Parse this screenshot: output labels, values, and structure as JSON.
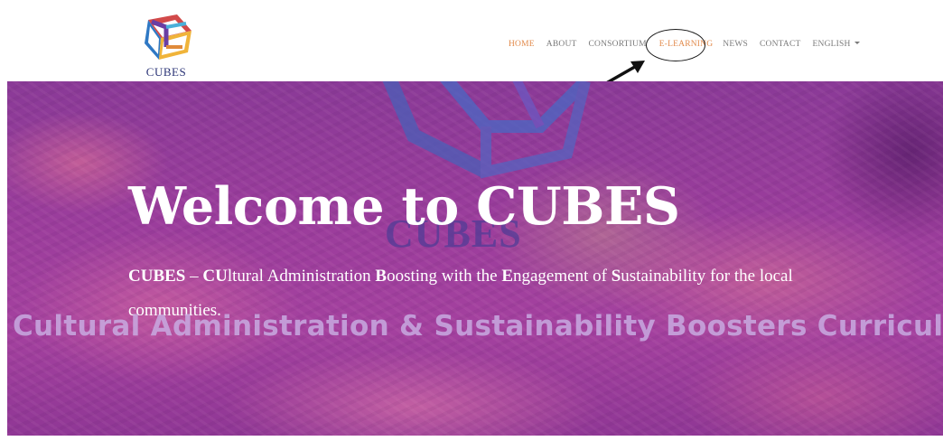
{
  "header": {
    "logo_text": "CUBES",
    "nav": [
      {
        "label": "HOME",
        "active": true
      },
      {
        "label": "ABOUT",
        "active": false
      },
      {
        "label": "CONSORTIUM",
        "active": false
      },
      {
        "label": "E-LEARNING",
        "active": false,
        "annotated": true
      },
      {
        "label": "NEWS",
        "active": false
      },
      {
        "label": "CONTACT",
        "active": false
      },
      {
        "label": "ENGLISH",
        "active": false,
        "dropdown": true
      }
    ]
  },
  "hero": {
    "title": "Welcome to CUBES",
    "background_logo_text": "CUBES",
    "description": {
      "parts": [
        {
          "text": "CUBES",
          "bold": true
        },
        {
          "text": " – ",
          "bold": false
        },
        {
          "text": "CU",
          "bold": true
        },
        {
          "text": "ltural Administration ",
          "bold": false
        },
        {
          "text": "B",
          "bold": true
        },
        {
          "text": "oosting with the ",
          "bold": false
        },
        {
          "text": "E",
          "bold": true
        },
        {
          "text": "ngagement of ",
          "bold": false
        },
        {
          "text": "S",
          "bold": true
        },
        {
          "text": "ustainability for the local communities.",
          "bold": false
        }
      ]
    },
    "curriculum_text": "Cultural Administration & Sustainability Boosters Curriculum"
  },
  "colors": {
    "nav_active": "#e28a4b",
    "nav_default": "#7a7a7a",
    "logo_text": "#2c3577",
    "hero_base": "#9b3d9c"
  },
  "icons": {
    "logo": "cube-logo-icon",
    "dropdown": "caret-down-icon",
    "annotation": "arrow-annotation-icon"
  }
}
